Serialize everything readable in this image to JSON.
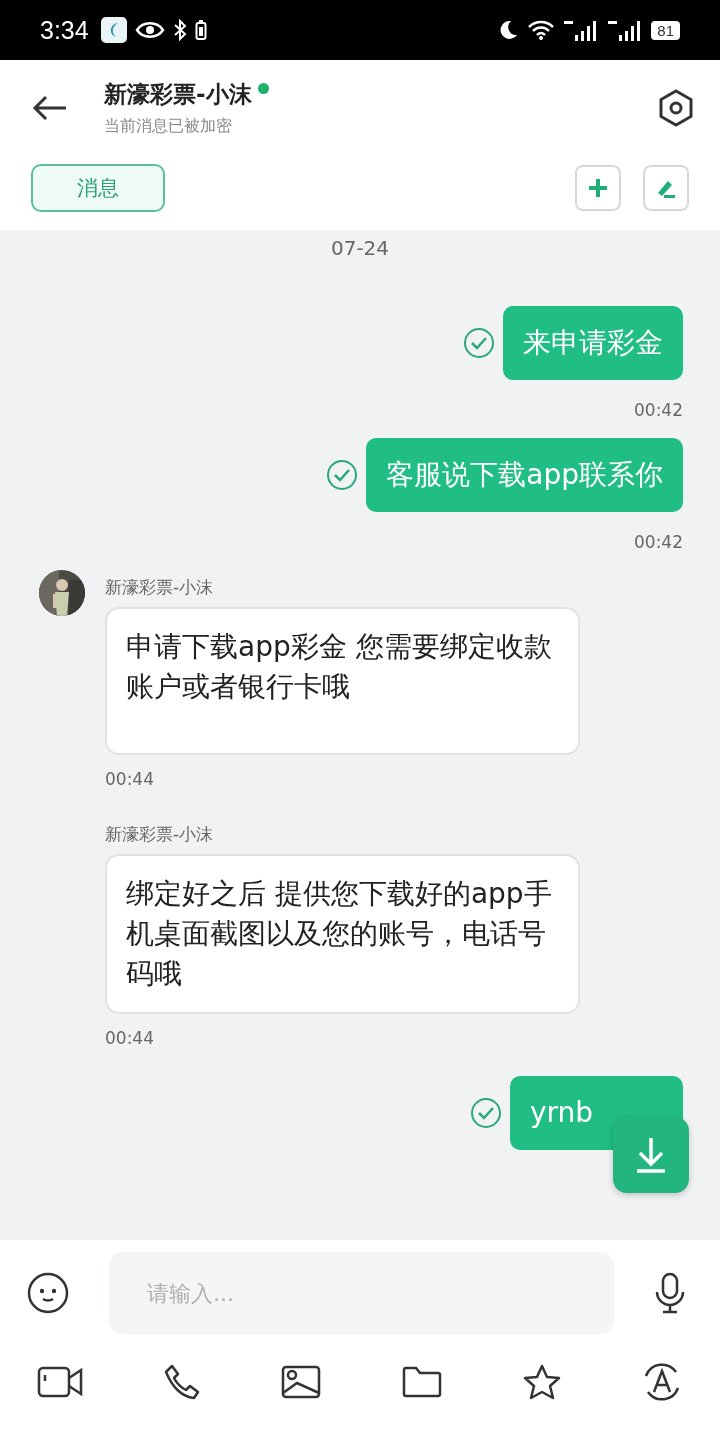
{
  "status_bar": {
    "time": "3:34",
    "battery": "81"
  },
  "header": {
    "title": "新濠彩票-小沫",
    "online": true,
    "subtitle": "当前消息已被加密"
  },
  "tabs": [
    {
      "label": "消息",
      "selected": true
    }
  ],
  "chat": {
    "date": "07-24",
    "messages": [
      {
        "kind": "outgoing",
        "text": "来申请彩金",
        "time": "00:42",
        "read": true
      },
      {
        "kind": "outgoing",
        "text": "客服说下载app联系你",
        "time": "00:42",
        "read": true
      },
      {
        "kind": "incoming",
        "sender": "新濠彩票-小沫",
        "avatar": true,
        "text": "申请下载app彩金 您需要绑定收款账户或者银行卡哦",
        "time": "00:44"
      },
      {
        "kind": "incoming",
        "sender": "新濠彩票-小沫",
        "avatar": false,
        "text": "绑定好之后 提供您下载好的app手机桌面截图以及您的账号，电话号码哦",
        "time": "00:44"
      },
      {
        "kind": "outgoing",
        "text": "yrnb",
        "read": true
      }
    ]
  },
  "input": {
    "placeholder": "请输入..."
  }
}
